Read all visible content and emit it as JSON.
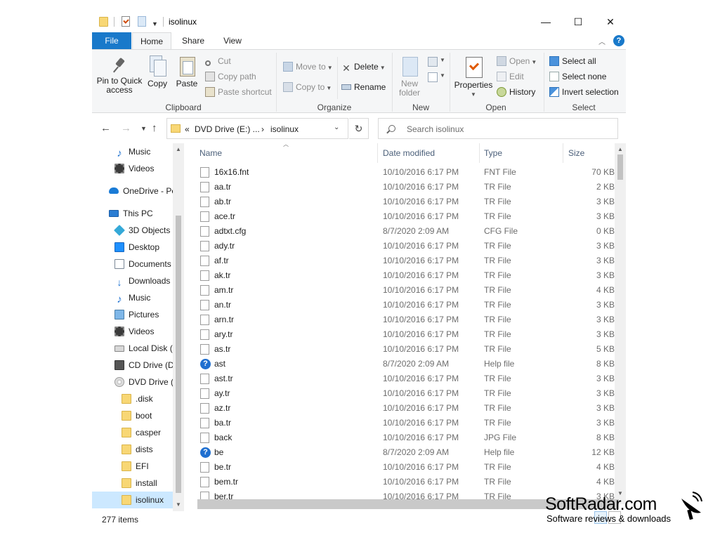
{
  "window": {
    "title": "isolinux",
    "controls": {
      "minimize": "—",
      "maximize": "☐",
      "close": "✕"
    }
  },
  "ribbon_tabs": [
    "File",
    "Home",
    "Share",
    "View"
  ],
  "ribbon": {
    "clipboard": {
      "label": "Clipboard",
      "pin_line1": "Pin to Quick",
      "pin_line2": "access",
      "copy": "Copy",
      "paste": "Paste",
      "cut": "Cut",
      "copy_path": "Copy path",
      "paste_shortcut": "Paste shortcut"
    },
    "organize": {
      "label": "Organize",
      "move_to": "Move to",
      "copy_to": "Copy to",
      "delete": "Delete",
      "rename": "Rename"
    },
    "new": {
      "label": "New",
      "new_folder_line1": "New",
      "new_folder_line2": "folder"
    },
    "open": {
      "label": "Open",
      "properties": "Properties",
      "open": "Open",
      "edit": "Edit",
      "history": "History"
    },
    "select": {
      "label": "Select",
      "select_all": "Select all",
      "select_none": "Select none",
      "invert_selection": "Invert selection"
    }
  },
  "address": {
    "prefix": "«",
    "crumb1": "DVD Drive (E:) ...",
    "sep": "›",
    "crumb2": "isolinux",
    "search_placeholder": "Search isolinux"
  },
  "nav_pane": [
    {
      "label": "Music",
      "icon": "music-icon"
    },
    {
      "label": "Videos",
      "icon": "video-icon"
    },
    {
      "label": "OneDrive - Pe",
      "icon": "onedrive-icon"
    },
    {
      "label": "This PC",
      "icon": "pc-icon"
    },
    {
      "label": "3D Objects",
      "icon": "3d-objects-icon"
    },
    {
      "label": "Desktop",
      "icon": "desktop-icon"
    },
    {
      "label": "Documents",
      "icon": "documents-icon"
    },
    {
      "label": "Downloads",
      "icon": "downloads-icon"
    },
    {
      "label": "Music",
      "icon": "music-icon"
    },
    {
      "label": "Pictures",
      "icon": "pictures-icon"
    },
    {
      "label": "Videos",
      "icon": "video-icon"
    },
    {
      "label": "Local Disk (",
      "icon": "local-disk-icon"
    },
    {
      "label": "CD Drive (D:",
      "icon": "cd-drive-icon"
    },
    {
      "label": "DVD Drive (E",
      "icon": "dvd-drive-icon"
    },
    {
      "label": ".disk",
      "icon": "folder-icon"
    },
    {
      "label": "boot",
      "icon": "folder-icon"
    },
    {
      "label": "casper",
      "icon": "folder-icon"
    },
    {
      "label": "dists",
      "icon": "folder-icon"
    },
    {
      "label": "EFI",
      "icon": "folder-icon"
    },
    {
      "label": "install",
      "icon": "folder-icon"
    },
    {
      "label": "isolinux",
      "icon": "folder-icon",
      "selected": true
    }
  ],
  "columns": {
    "name": "Name",
    "date": "Date modified",
    "type": "Type",
    "size": "Size"
  },
  "files": [
    {
      "name": "16x16.fnt",
      "date": "10/10/2016 6:17 PM",
      "type": "FNT File",
      "size": "70 KB",
      "icon": "file-icon"
    },
    {
      "name": "aa.tr",
      "date": "10/10/2016 6:17 PM",
      "type": "TR File",
      "size": "2 KB",
      "icon": "file-icon"
    },
    {
      "name": "ab.tr",
      "date": "10/10/2016 6:17 PM",
      "type": "TR File",
      "size": "3 KB",
      "icon": "file-icon"
    },
    {
      "name": "ace.tr",
      "date": "10/10/2016 6:17 PM",
      "type": "TR File",
      "size": "3 KB",
      "icon": "file-icon"
    },
    {
      "name": "adtxt.cfg",
      "date": "8/7/2020 2:09 AM",
      "type": "CFG File",
      "size": "0 KB",
      "icon": "file-icon"
    },
    {
      "name": "ady.tr",
      "date": "10/10/2016 6:17 PM",
      "type": "TR File",
      "size": "3 KB",
      "icon": "file-icon"
    },
    {
      "name": "af.tr",
      "date": "10/10/2016 6:17 PM",
      "type": "TR File",
      "size": "3 KB",
      "icon": "file-icon"
    },
    {
      "name": "ak.tr",
      "date": "10/10/2016 6:17 PM",
      "type": "TR File",
      "size": "3 KB",
      "icon": "file-icon"
    },
    {
      "name": "am.tr",
      "date": "10/10/2016 6:17 PM",
      "type": "TR File",
      "size": "4 KB",
      "icon": "file-icon"
    },
    {
      "name": "an.tr",
      "date": "10/10/2016 6:17 PM",
      "type": "TR File",
      "size": "3 KB",
      "icon": "file-icon"
    },
    {
      "name": "arn.tr",
      "date": "10/10/2016 6:17 PM",
      "type": "TR File",
      "size": "3 KB",
      "icon": "file-icon"
    },
    {
      "name": "ary.tr",
      "date": "10/10/2016 6:17 PM",
      "type": "TR File",
      "size": "3 KB",
      "icon": "file-icon"
    },
    {
      "name": "as.tr",
      "date": "10/10/2016 6:17 PM",
      "type": "TR File",
      "size": "5 KB",
      "icon": "file-icon"
    },
    {
      "name": "ast",
      "date": "8/7/2020 2:09 AM",
      "type": "Help file",
      "size": "8 KB",
      "icon": "help-file-icon"
    },
    {
      "name": "ast.tr",
      "date": "10/10/2016 6:17 PM",
      "type": "TR File",
      "size": "3 KB",
      "icon": "file-icon"
    },
    {
      "name": "ay.tr",
      "date": "10/10/2016 6:17 PM",
      "type": "TR File",
      "size": "3 KB",
      "icon": "file-icon"
    },
    {
      "name": "az.tr",
      "date": "10/10/2016 6:17 PM",
      "type": "TR File",
      "size": "3 KB",
      "icon": "file-icon"
    },
    {
      "name": "ba.tr",
      "date": "10/10/2016 6:17 PM",
      "type": "TR File",
      "size": "3 KB",
      "icon": "file-icon"
    },
    {
      "name": "back",
      "date": "10/10/2016 6:17 PM",
      "type": "JPG File",
      "size": "8 KB",
      "icon": "file-icon"
    },
    {
      "name": "be",
      "date": "8/7/2020 2:09 AM",
      "type": "Help file",
      "size": "12 KB",
      "icon": "help-file-icon"
    },
    {
      "name": "be.tr",
      "date": "10/10/2016 6:17 PM",
      "type": "TR File",
      "size": "4 KB",
      "icon": "file-icon"
    },
    {
      "name": "bem.tr",
      "date": "10/10/2016 6:17 PM",
      "type": "TR File",
      "size": "4 KB",
      "icon": "file-icon"
    },
    {
      "name": "ber.tr",
      "date": "10/10/2016 6:17 PM",
      "type": "TR File",
      "size": "3 KB",
      "icon": "file-icon"
    }
  ],
  "status": {
    "item_count": "277 items"
  },
  "watermark": {
    "title": "SoftRadar.com",
    "subtitle": "Software reviews & downloads"
  }
}
